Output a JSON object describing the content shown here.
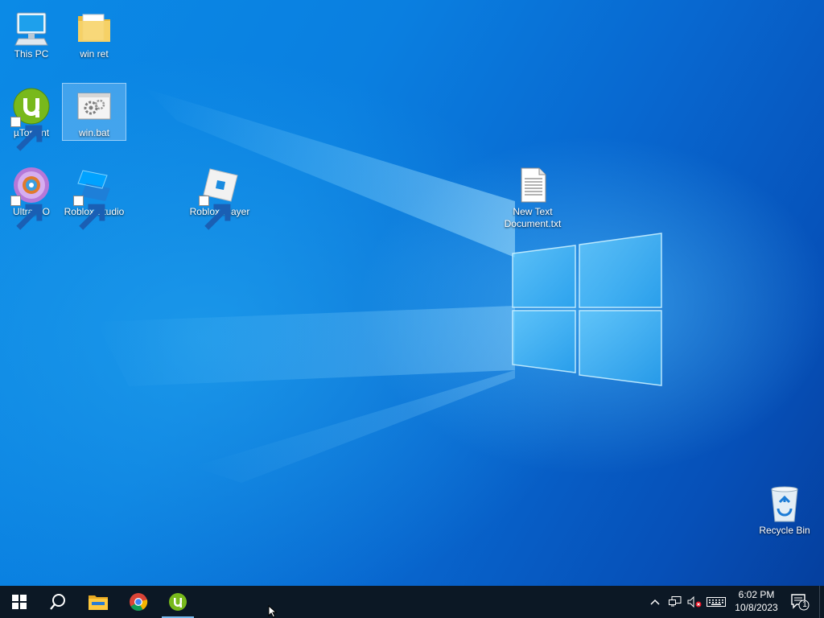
{
  "desktop": {
    "icons": [
      {
        "label": "This PC"
      },
      {
        "label": "win ret"
      },
      {
        "label": "µTorrent"
      },
      {
        "label": "win.bat"
      },
      {
        "label": "UltraISO"
      },
      {
        "label": "Roblox Studio"
      },
      {
        "label": "Roblox Player"
      },
      {
        "label": "New Text Document.txt"
      },
      {
        "label": "Recycle Bin"
      }
    ],
    "selected_icon": "win.bat"
  },
  "taskbar": {
    "start_icon": "windows-start-icon",
    "search_icon": "search-icon",
    "pinned": [
      {
        "name": "file-explorer",
        "icon": "folder-icon"
      },
      {
        "name": "google-chrome",
        "icon": "chrome-icon"
      },
      {
        "name": "utorrent",
        "icon": "utorrent-icon",
        "active": true
      }
    ],
    "tray": {
      "icons": [
        "chevron-up-icon",
        "network-icon",
        "volume-muted-icon",
        "keyboard-icon"
      ],
      "time": "6:02 PM",
      "date": "10/8/2023",
      "notification_count": "1"
    }
  },
  "colors": {
    "taskbar": "#0c1825",
    "accent": "#76b9ed",
    "desktop_light": "#0b8ae6",
    "desktop_dark": "#053f9e"
  }
}
